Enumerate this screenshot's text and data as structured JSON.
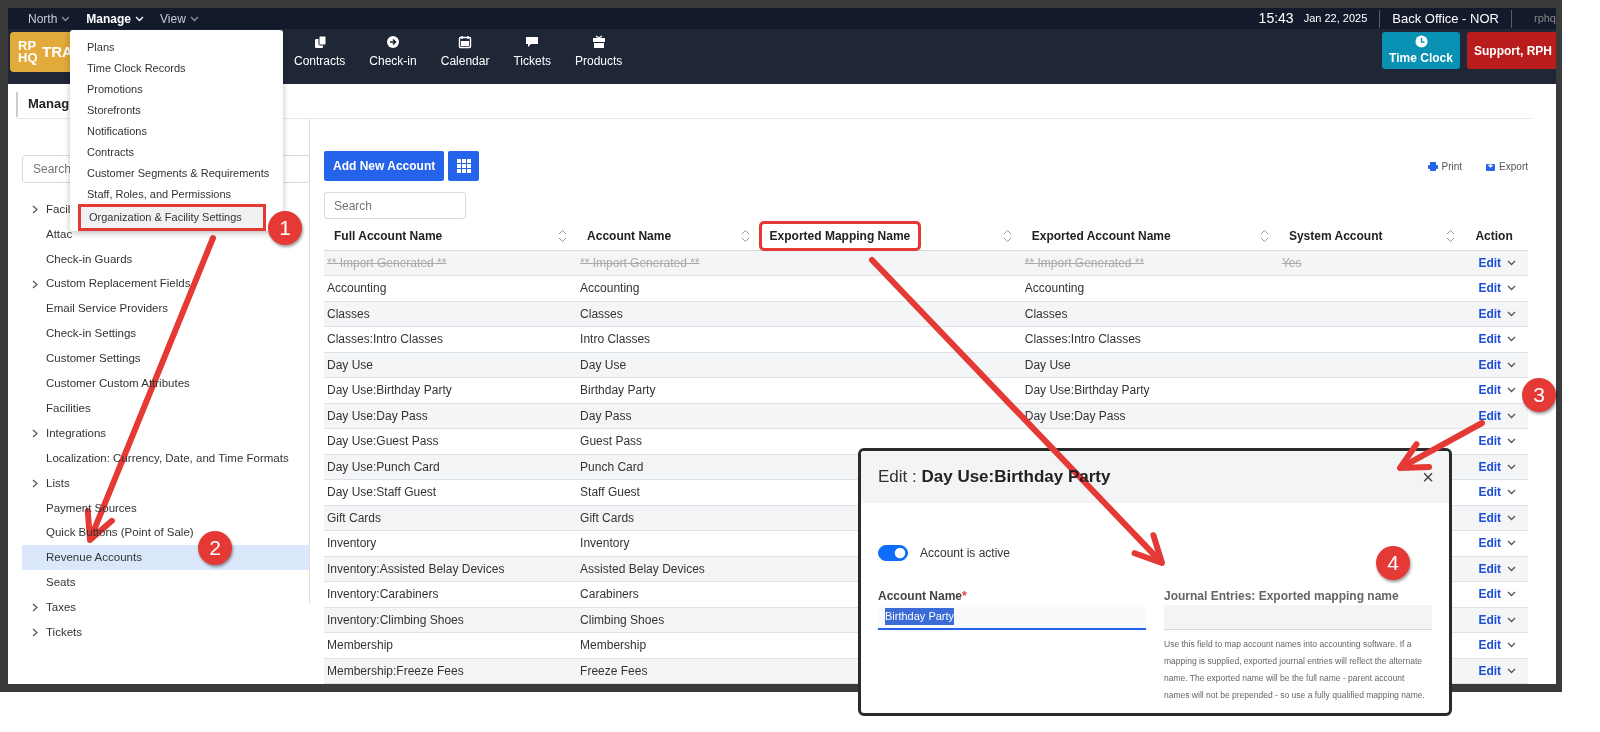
{
  "top_bar": {
    "menus": [
      {
        "label": "North",
        "selected": false
      },
      {
        "label": "Manage",
        "selected": true
      },
      {
        "label": "View",
        "selected": false
      }
    ],
    "time": "15:43",
    "date": "Jan 22, 2025",
    "location": "Back Office - NOR",
    "user": "rphq"
  },
  "nav_bar": {
    "logo": "RP HQ",
    "logo_text": "TRA",
    "items": [
      {
        "label": "Contracts"
      },
      {
        "label": "Check-in"
      },
      {
        "label": "Calendar"
      },
      {
        "label": "Tickets"
      },
      {
        "label": "Products"
      }
    ],
    "time_clock": "Time Clock",
    "support": "Support, RPH"
  },
  "manage_menu": [
    {
      "label": "Plans",
      "highlighted": false
    },
    {
      "label": "Time Clock Records",
      "highlighted": false
    },
    {
      "label": "Promotions",
      "highlighted": false
    },
    {
      "label": "Storefronts",
      "highlighted": false
    },
    {
      "label": "Notifications",
      "highlighted": false
    },
    {
      "label": "Contracts",
      "highlighted": false
    },
    {
      "label": "Customer Segments & Requirements",
      "highlighted": false
    },
    {
      "label": "Staff, Roles, and Permissions",
      "highlighted": false
    },
    {
      "label": "Organization & Facility Settings",
      "highlighted": true
    }
  ],
  "page_title": "Manag",
  "sidebar": {
    "search_placeholder": "Search",
    "items": [
      {
        "label": "Facil",
        "kind": "group",
        "selected": false
      },
      {
        "label": "Attac",
        "kind": "leaf",
        "selected": false
      },
      {
        "label": "Check-in Guards",
        "kind": "leaf",
        "selected": false
      },
      {
        "label": "Custom Replacement Fields",
        "kind": "group",
        "selected": false
      },
      {
        "label": "Email Service Providers",
        "kind": "leaf",
        "selected": false
      },
      {
        "label": "Check-in Settings",
        "kind": "leaf",
        "selected": false
      },
      {
        "label": "Customer Settings",
        "kind": "leaf",
        "selected": false
      },
      {
        "label": "Customer Custom Attributes",
        "kind": "leaf",
        "selected": false
      },
      {
        "label": "Facilities",
        "kind": "leaf",
        "selected": false
      },
      {
        "label": "Integrations",
        "kind": "group",
        "selected": false
      },
      {
        "label": "Localization: Currency, Date, and Time Formats",
        "kind": "leaf",
        "selected": false
      },
      {
        "label": "Lists",
        "kind": "group",
        "selected": false
      },
      {
        "label": "Payment Sources",
        "kind": "leaf",
        "selected": false
      },
      {
        "label": "Quick Buttons (Point of Sale)",
        "kind": "leaf",
        "selected": false
      },
      {
        "label": "Revenue Accounts",
        "kind": "leaf",
        "selected": true
      },
      {
        "label": "Seats",
        "kind": "leaf",
        "selected": false
      },
      {
        "label": "Taxes",
        "kind": "group",
        "selected": false
      },
      {
        "label": "Tickets",
        "kind": "group",
        "selected": false
      }
    ]
  },
  "toolbar": {
    "add_button": "Add New Account",
    "print": "Print",
    "export": "Export",
    "search_placeholder": "Search"
  },
  "table": {
    "columns": [
      {
        "label": "Full Account Name",
        "sortable": true,
        "highlighted": false
      },
      {
        "label": "Account Name",
        "sortable": true,
        "highlighted": false
      },
      {
        "label": "Exported Mapping Name",
        "sortable": true,
        "highlighted": true
      },
      {
        "label": "Exported Account Name",
        "sortable": true,
        "highlighted": false
      },
      {
        "label": "System Account",
        "sortable": true,
        "highlighted": false
      },
      {
        "label": "Action",
        "sortable": false,
        "highlighted": false
      }
    ],
    "rows": [
      {
        "full": "** Import Generated **",
        "name": "** Import Generated **",
        "exported": "** Import Generated **",
        "system": "Yes",
        "action": "Edit",
        "struck": true
      },
      {
        "full": "Accounting",
        "name": "Accounting",
        "exported": "Accounting",
        "action": "Edit",
        "struck": false
      },
      {
        "full": "Classes",
        "name": "Classes",
        "exported": "Classes",
        "action": "Edit",
        "struck": false
      },
      {
        "full": "Classes:Intro Classes",
        "name": "Intro Classes",
        "exported": "Classes:Intro Classes",
        "action": "Edit",
        "struck": false
      },
      {
        "full": "Day Use",
        "name": "Day Use",
        "exported": "Day Use",
        "action": "Edit",
        "struck": false
      },
      {
        "full": "Day Use:Birthday Party",
        "name": "Birthday Party",
        "exported": "Day Use:Birthday Party",
        "action": "Edit",
        "struck": false
      },
      {
        "full": "Day Use:Day Pass",
        "name": "Day Pass",
        "exported": "Day Use:Day Pass",
        "action": "Edit",
        "struck": false
      },
      {
        "full": "Day Use:Guest Pass",
        "name": "Guest Pass",
        "action": "Edit",
        "struck": false
      },
      {
        "full": "Day Use:Punch Card",
        "name": "Punch Card",
        "action": "Edit",
        "struck": false
      },
      {
        "full": "Day Use:Staff Guest",
        "name": "Staff Guest",
        "action": "Edit",
        "struck": false
      },
      {
        "full": "Gift Cards",
        "name": "Gift Cards",
        "action": "Edit",
        "struck": false
      },
      {
        "full": "Inventory",
        "name": "Inventory",
        "action": "Edit",
        "struck": false
      },
      {
        "full": "Inventory:Assisted Belay Devices",
        "name": "Assisted Belay Devices",
        "action": "Edit",
        "struck": false
      },
      {
        "full": "Inventory:Carabiners",
        "name": "Carabiners",
        "action": "Edit",
        "struck": false
      },
      {
        "full": "Inventory:Climbing Shoes",
        "name": "Climbing Shoes",
        "action": "Edit",
        "struck": false
      },
      {
        "full": "Membership",
        "name": "Membership",
        "action": "Edit",
        "struck": false
      },
      {
        "full": "Membership:Freeze Fees",
        "name": "Freeze Fees",
        "action": "Edit",
        "struck": false
      }
    ]
  },
  "modal": {
    "title": "Edit : **Day Use:Birthday Party**",
    "close": "×",
    "active_label": "Account is active",
    "active": true,
    "name_label": "Account Name",
    "required_mark": "*",
    "name_value": "Birthday Party",
    "mapping_label": "Journal Entries: Exported mapping name",
    "mapping_help": "Use this field to map account names into accounting software. If a mapping is supplied, exported journal entries will reflect the alternate name. The exported name will be the full name - parent account names will not be prepended - so use a fully qualified mapping name."
  },
  "annotations": {
    "callouts": [
      {
        "number": "1"
      },
      {
        "number": "2"
      },
      {
        "number": "3"
      },
      {
        "number": "4"
      }
    ]
  }
}
